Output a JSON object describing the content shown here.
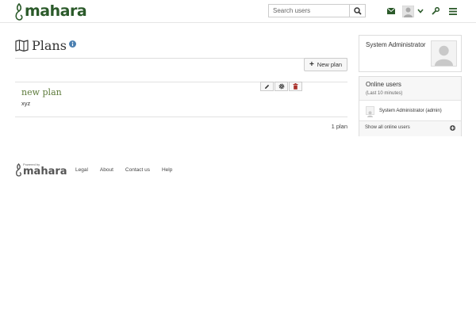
{
  "header": {
    "logo_text": "mahara",
    "search_placeholder": "Search users"
  },
  "main": {
    "page_title": "Plans",
    "new_plan_label": "New plan",
    "plans": [
      {
        "title": "new plan",
        "description": "xyz"
      }
    ],
    "plan_count": "1 plan"
  },
  "sidebar": {
    "profile_name": "System Administrator",
    "online": {
      "title": "Online users",
      "subtitle": "(Last 10 minutes)",
      "users": [
        "System Administrator (admin)"
      ],
      "show_all": "Show all online users"
    }
  },
  "footer": {
    "powered_by": "Powered by",
    "logo_text": "mahara",
    "links": [
      "Legal",
      "About",
      "Contact us",
      "Help"
    ]
  },
  "colors": {
    "brand_green": "#2b5a2a",
    "plan_title": "#5c7a3a",
    "delete_red": "#a9302a"
  }
}
